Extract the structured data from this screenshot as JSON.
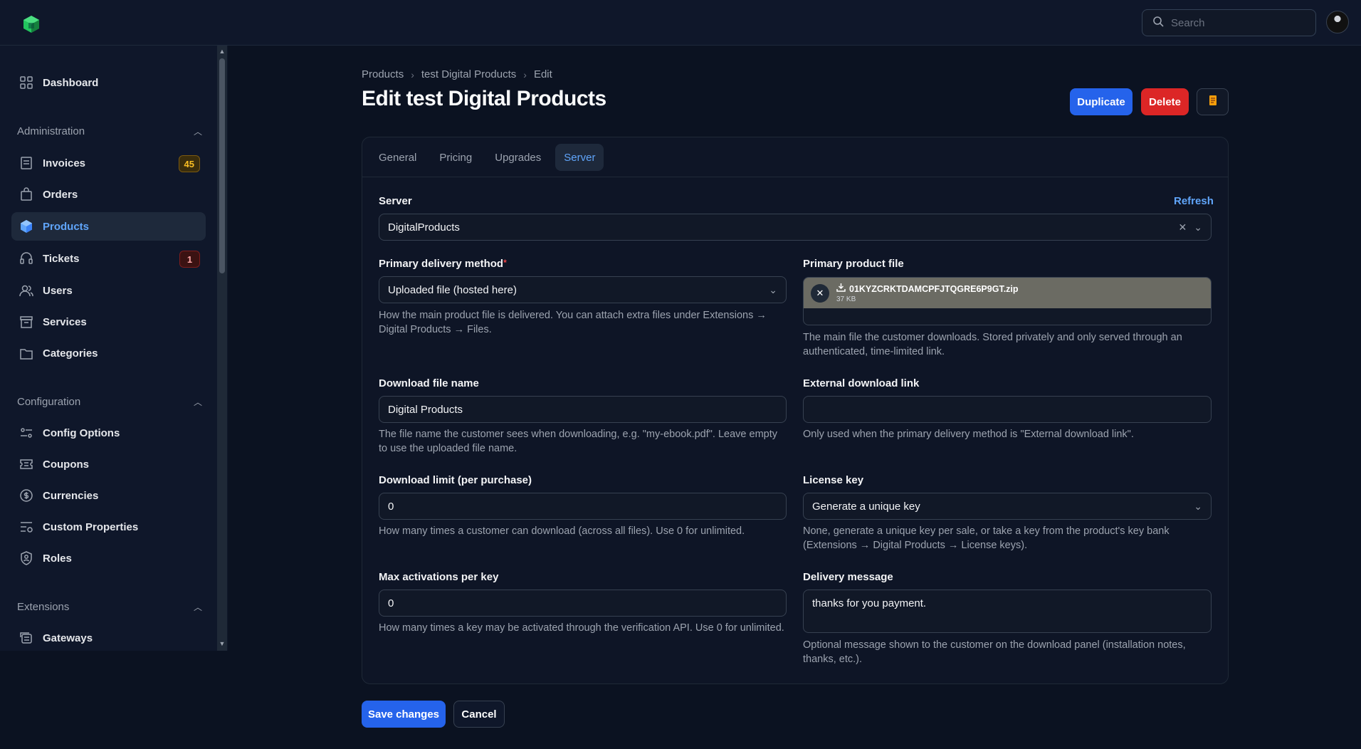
{
  "topbar": {
    "search_placeholder": "Search"
  },
  "sidebar": {
    "dashboard": "Dashboard",
    "groups": {
      "administration": "Administration",
      "configuration": "Configuration",
      "extensions": "Extensions"
    },
    "items": {
      "invoices": {
        "label": "Invoices",
        "badge": "45"
      },
      "orders": {
        "label": "Orders"
      },
      "products": {
        "label": "Products"
      },
      "tickets": {
        "label": "Tickets",
        "badge": "1"
      },
      "users": {
        "label": "Users"
      },
      "services": {
        "label": "Services"
      },
      "categories": {
        "label": "Categories"
      },
      "config_options": {
        "label": "Config Options"
      },
      "coupons": {
        "label": "Coupons"
      },
      "currencies": {
        "label": "Currencies"
      },
      "custom_properties": {
        "label": "Custom Properties"
      },
      "roles": {
        "label": "Roles"
      },
      "gateways": {
        "label": "Gateways"
      }
    }
  },
  "breadcrumb": [
    "Products",
    "test Digital Products",
    "Edit"
  ],
  "page": {
    "title": "Edit test Digital Products",
    "duplicate": "Duplicate",
    "delete": "Delete"
  },
  "tabs": [
    "General",
    "Pricing",
    "Upgrades",
    "Server"
  ],
  "form": {
    "server": {
      "label": "Server",
      "refresh": "Refresh",
      "value": "DigitalProducts"
    },
    "delivery_method": {
      "label": "Primary delivery method",
      "value": "Uploaded file (hosted here)",
      "help": "How the main product file is delivered. You can attach extra files under Extensions → Digital Products → Files."
    },
    "product_file": {
      "label": "Primary product file",
      "file_name": "01KYZCRKTDAMCPFJTQGRE6P9GT.zip",
      "file_size": "37 KB",
      "help": "The main file the customer downloads. Stored privately and only served through an authenticated, time-limited link."
    },
    "download_file_name": {
      "label": "Download file name",
      "value": "Digital Products",
      "help": "The file name the customer sees when downloading, e.g. \"my-ebook.pdf\". Leave empty to use the uploaded file name."
    },
    "external_link": {
      "label": "External download link",
      "value": "",
      "help": "Only used when the primary delivery method is \"External download link\"."
    },
    "download_limit": {
      "label": "Download limit (per purchase)",
      "value": "0",
      "help": "How many times a customer can download (across all files). Use 0 for unlimited."
    },
    "license_key": {
      "label": "License key",
      "value": "Generate a unique key",
      "help": "None, generate a unique key per sale, or take a key from the product's key bank (Extensions → Digital Products → License keys)."
    },
    "max_activations": {
      "label": "Max activations per key",
      "value": "0",
      "help": "How many times a key may be activated through the verification API. Use 0 for unlimited."
    },
    "delivery_message": {
      "label": "Delivery message",
      "value": "thanks for you payment.",
      "help": "Optional message shown to the customer on the download panel (installation notes, thanks, etc.)."
    }
  },
  "footer": {
    "save": "Save changes",
    "cancel": "Cancel"
  },
  "colors": {
    "accent": "#2563eb",
    "danger": "#dc2626",
    "background": "#0b1221"
  }
}
